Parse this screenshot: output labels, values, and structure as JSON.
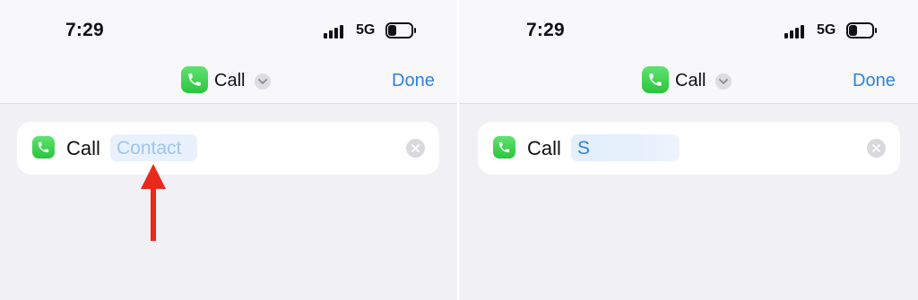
{
  "panels": [
    {
      "status": {
        "time": "7:29",
        "network": "5G"
      },
      "nav": {
        "title": "Call",
        "done": "Done"
      },
      "action": {
        "label": "Call",
        "parameter": "Contact"
      }
    },
    {
      "status": {
        "time": "7:29",
        "network": "5G"
      },
      "nav": {
        "title": "Call",
        "done": "Done"
      },
      "action": {
        "label": "Call",
        "parameter": "S"
      }
    }
  ],
  "colors": {
    "accent": "#2a82e4",
    "app_green": "#34c759",
    "annotation_arrow": "#e8291c",
    "background": "#f1f0f5"
  },
  "icons": [
    "phone-icon",
    "chevron-down-icon",
    "clear-icon",
    "signal-icon",
    "battery-icon"
  ]
}
